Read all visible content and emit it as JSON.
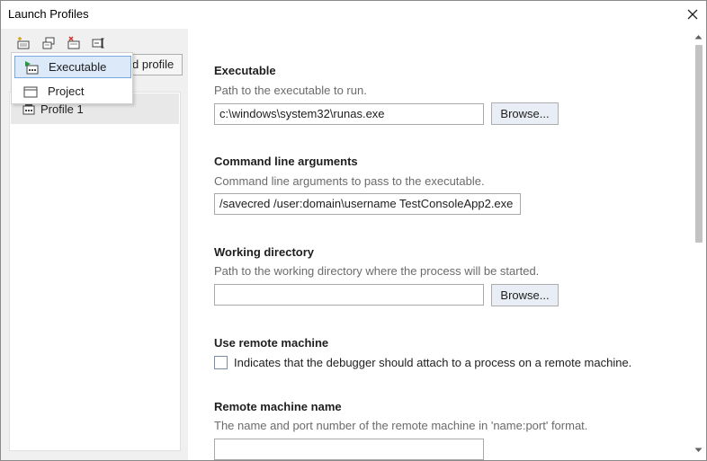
{
  "window": {
    "title": "Launch Profiles"
  },
  "toolbar": {
    "new_profile_icon": "new-profile-icon",
    "copy_profile_icon": "copy-profile-icon",
    "delete_profile_icon": "delete-profile-icon",
    "rename_profile_icon": "rename-profile-icon"
  },
  "add_profile_button": "Add profile",
  "add_profile_button_visible": "d profile",
  "dropdown": {
    "items": [
      {
        "label": "Executable",
        "icon": "executable-icon"
      },
      {
        "label": "Project",
        "icon": "project-icon"
      }
    ]
  },
  "profiles": [
    {
      "label": "Profile 1",
      "icon": "executable-icon"
    }
  ],
  "form": {
    "executable": {
      "title": "Executable",
      "description": "Path to the executable to run.",
      "value": "c:\\windows\\system32\\runas.exe",
      "browse": "Browse..."
    },
    "arguments": {
      "title": "Command line arguments",
      "description": "Command line arguments to pass to the executable.",
      "value": "/savecred /user:domain\\username TestConsoleApp2.exe"
    },
    "working_directory": {
      "title": "Working directory",
      "description": "Path to the working directory where the process will be started.",
      "value": "",
      "browse": "Browse..."
    },
    "remote": {
      "title": "Use remote machine",
      "checkbox_label": "Indicates that the debugger should attach to a process on a remote machine.",
      "checked": false
    },
    "remote_name": {
      "title": "Remote machine name",
      "description": "The name and port number of the remote machine in 'name:port' format.",
      "value": ""
    }
  },
  "colors": {
    "selection": "#dbe9f9",
    "selection_border": "#7aa7dd",
    "pane": "#f0f0f0"
  }
}
